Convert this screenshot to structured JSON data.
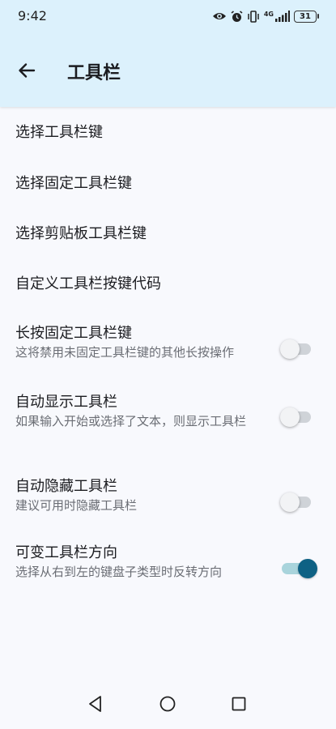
{
  "status_bar": {
    "time": "9:42",
    "network_label": "4G",
    "battery": "31"
  },
  "header": {
    "title": "工具栏"
  },
  "settings": {
    "items": [
      {
        "title": "选择工具栏键"
      },
      {
        "title": "选择固定工具栏键"
      },
      {
        "title": "选择剪贴板工具栏键"
      },
      {
        "title": "自定义工具栏按键代码"
      },
      {
        "title": "长按固定工具栏键",
        "summary": "这将禁用未固定工具栏键的其他长按操作",
        "enabled": false
      },
      {
        "title": "自动显示工具栏",
        "summary": "如果输入开始或选择了文本，则显示工具栏",
        "enabled": false
      },
      {
        "title": "自动隐藏工具栏",
        "summary": "建议可用时隐藏工具栏",
        "enabled": false
      },
      {
        "title": "可变工具栏方向",
        "summary": "选择从右到左的键盘子类型时反转方向",
        "enabled": true
      }
    ]
  },
  "colors": {
    "header_bg": "#dcf1fc",
    "page_bg": "#f8f9fd",
    "accent": "#0e6184"
  }
}
